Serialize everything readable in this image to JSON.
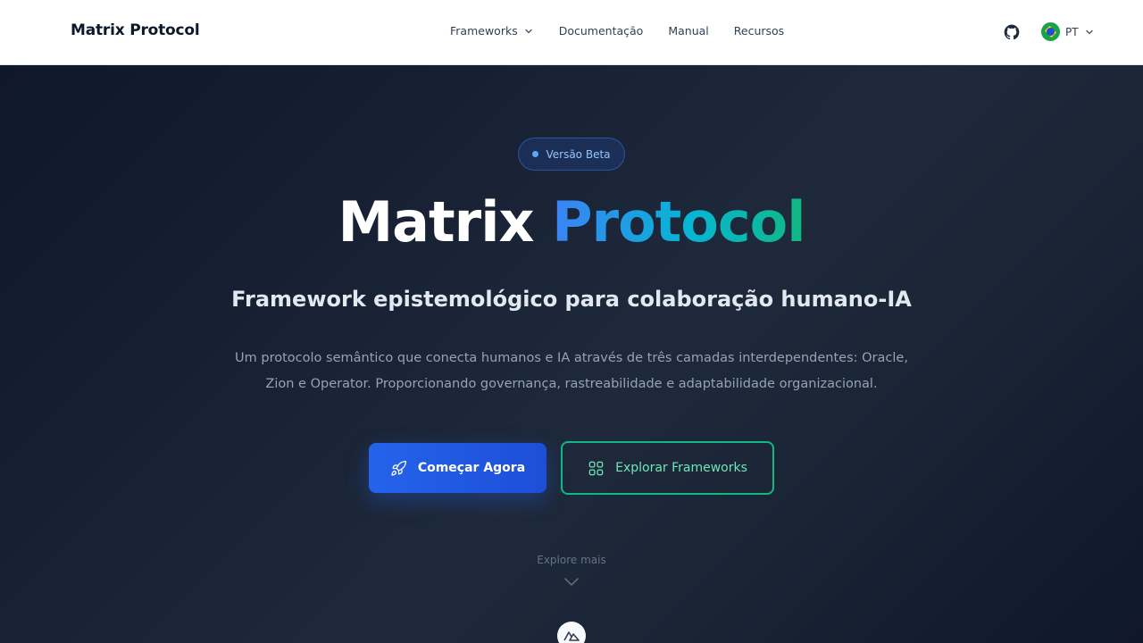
{
  "header": {
    "brand": "Matrix Protocol",
    "nav": [
      {
        "label": "Frameworks",
        "has_dropdown": true
      },
      {
        "label": "Documentação"
      },
      {
        "label": "Manual"
      },
      {
        "label": "Recursos"
      }
    ],
    "github_icon": "github-icon",
    "language": {
      "code": "PT",
      "flag": "brazil-flag-icon"
    }
  },
  "hero": {
    "badge": "Versão Beta",
    "title_part1": "Matrix",
    "title_part2": "Protocol",
    "subtitle": "Framework epistemológico para colaboração humano-IA",
    "description_line1": "Um protocolo semântico que conecta humanos e IA através de três camadas interdependentes: Oracle,",
    "description_line2": "Zion e Operator. Proporcionando governança, rastreabilidade e adaptabilidade organizacional.",
    "primary_button": {
      "label": "Começar Agora",
      "icon": "rocket-icon"
    },
    "secondary_button": {
      "label": "Explorar Frameworks",
      "icon": "grid-icon"
    },
    "explore_more": "Explore mais"
  },
  "colors": {
    "primary": "#2563eb",
    "accent_green": "#10b981",
    "background": "#0f172a"
  }
}
